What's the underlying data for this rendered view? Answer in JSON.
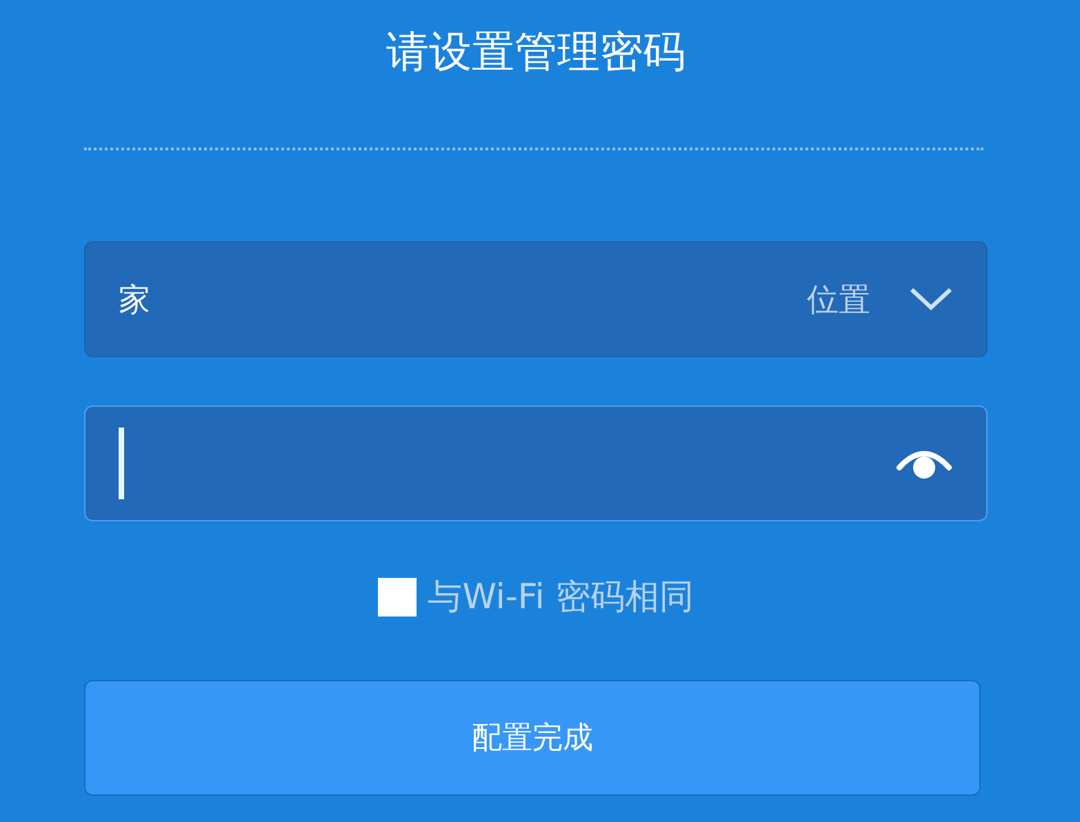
{
  "title": "请设置管理密码",
  "location": {
    "value": "家",
    "label": "位置"
  },
  "password": {
    "focused": true,
    "visible": true
  },
  "same_as_wifi": {
    "label": "与Wi-Fi 密码相同",
    "checked": false
  },
  "submit": {
    "label": "配置完成"
  }
}
